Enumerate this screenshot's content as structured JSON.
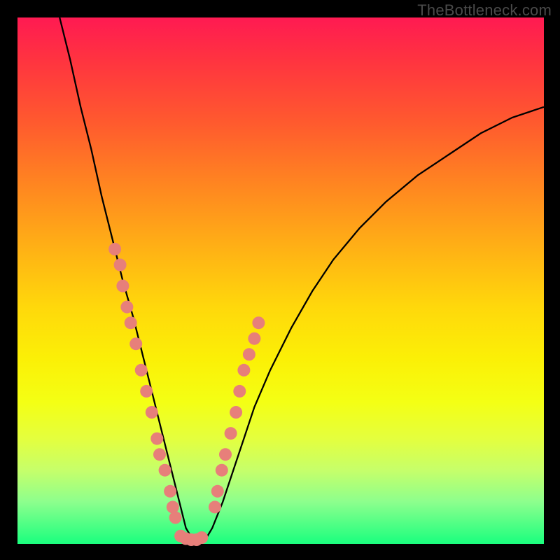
{
  "watermark": "TheBottleneck.com",
  "chart_data": {
    "type": "line",
    "title": "",
    "xlabel": "",
    "ylabel": "",
    "xlim": [
      0,
      100
    ],
    "ylim": [
      0,
      100
    ],
    "grid": false,
    "legend": false,
    "curve_x": [
      8,
      10,
      12,
      14,
      16,
      18,
      20,
      22,
      24,
      25.5,
      27,
      28.5,
      30,
      31,
      32,
      33.5,
      35.5,
      37,
      39,
      41,
      43,
      45,
      48,
      52,
      56,
      60,
      65,
      70,
      76,
      82,
      88,
      94,
      100
    ],
    "curve_y": [
      100,
      92,
      83,
      75,
      66,
      58,
      50,
      43,
      35,
      29,
      23,
      17,
      11,
      7,
      3,
      0.5,
      0.5,
      3,
      8,
      14,
      20,
      26,
      33,
      41,
      48,
      54,
      60,
      65,
      70,
      74,
      78,
      81,
      83
    ],
    "dots_left": [
      {
        "x": 18.5,
        "y": 56
      },
      {
        "x": 19.5,
        "y": 53
      },
      {
        "x": 20.0,
        "y": 49
      },
      {
        "x": 20.8,
        "y": 45
      },
      {
        "x": 21.5,
        "y": 42
      },
      {
        "x": 22.5,
        "y": 38
      },
      {
        "x": 23.5,
        "y": 33
      },
      {
        "x": 24.5,
        "y": 29
      },
      {
        "x": 25.5,
        "y": 25
      },
      {
        "x": 26.5,
        "y": 20
      },
      {
        "x": 27.0,
        "y": 17
      },
      {
        "x": 28.0,
        "y": 14
      },
      {
        "x": 29.0,
        "y": 10
      },
      {
        "x": 29.5,
        "y": 7
      },
      {
        "x": 30.0,
        "y": 5
      }
    ],
    "dots_bottom": [
      {
        "x": 31.0,
        "y": 1.5
      },
      {
        "x": 32.0,
        "y": 1.0
      },
      {
        "x": 33.0,
        "y": 0.8
      },
      {
        "x": 34.0,
        "y": 0.8
      },
      {
        "x": 35.0,
        "y": 1.2
      }
    ],
    "dots_right": [
      {
        "x": 37.5,
        "y": 7
      },
      {
        "x": 38.0,
        "y": 10
      },
      {
        "x": 38.8,
        "y": 14
      },
      {
        "x": 39.5,
        "y": 17
      },
      {
        "x": 40.5,
        "y": 21
      },
      {
        "x": 41.5,
        "y": 25
      },
      {
        "x": 42.2,
        "y": 29
      },
      {
        "x": 43.0,
        "y": 33
      },
      {
        "x": 44.0,
        "y": 36
      },
      {
        "x": 45.0,
        "y": 39
      },
      {
        "x": 45.8,
        "y": 42
      }
    ],
    "gradient_stops": [
      {
        "pos": 0,
        "color": "#ff1a52"
      },
      {
        "pos": 20,
        "color": "#ff5a2e"
      },
      {
        "pos": 45,
        "color": "#ffb514"
      },
      {
        "pos": 65,
        "color": "#fbf006"
      },
      {
        "pos": 85,
        "color": "#c6ff6a"
      },
      {
        "pos": 100,
        "color": "#1aff7e"
      }
    ]
  }
}
